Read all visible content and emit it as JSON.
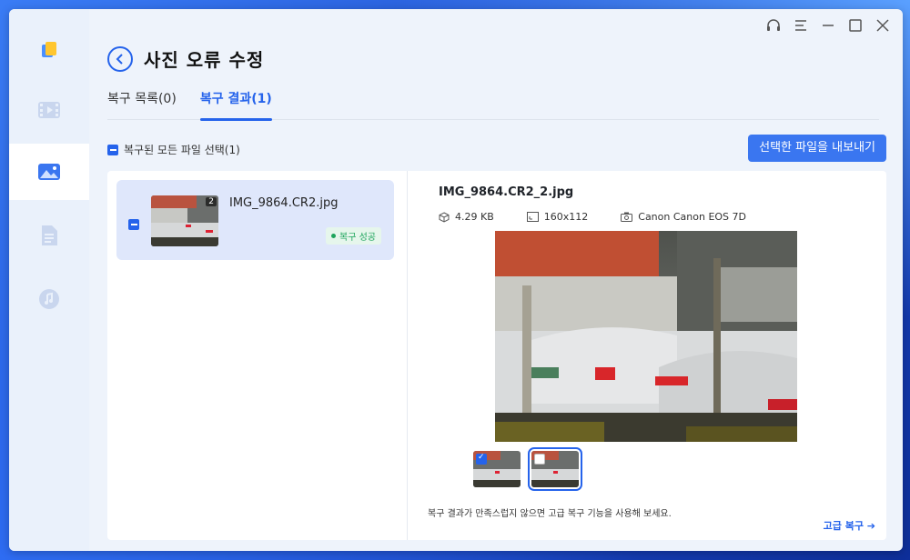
{
  "window": {
    "title": "사진 오류 수정",
    "controls": [
      "headset-icon",
      "menu-icon",
      "minimize-icon",
      "maximize-icon",
      "close-icon"
    ]
  },
  "sidebar": {
    "items": [
      {
        "icon": "app-logo-icon",
        "active": false
      },
      {
        "icon": "video-icon",
        "active": false
      },
      {
        "icon": "photo-icon",
        "active": true
      },
      {
        "icon": "document-icon",
        "active": false
      },
      {
        "icon": "music-icon",
        "active": false
      }
    ]
  },
  "tabs": [
    {
      "label": "복구 목록(0)",
      "active": false
    },
    {
      "label": "복구 결과(1)",
      "active": true
    }
  ],
  "toolbar": {
    "select_all_label": "복구된 모든 파일 선택(1)",
    "export_label": "선택한 파일을 내보내기"
  },
  "files": [
    {
      "name": "IMG_9864.CR2.jpg",
      "badge": "2",
      "status": "복구 성공"
    }
  ],
  "detail": {
    "name": "IMG_9864.CR2_2.jpg",
    "size": "4.29 KB",
    "dimensions": "160x112",
    "camera": "Canon Canon EOS 7D",
    "hint": "복구 결과가 만족스럽지 않으면 고급 복구 기능을 사용해 보세요.",
    "advanced_link": "고급 복구 ➔"
  },
  "colors": {
    "accent": "#2563eb",
    "success": "#1ea45c"
  }
}
